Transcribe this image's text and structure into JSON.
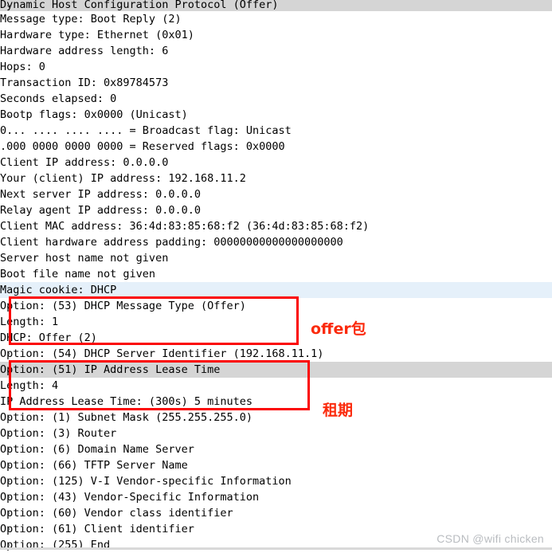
{
  "window": {
    "app": "Wireshark packet detail pane",
    "watermark": "CSDN @wifi chicken"
  },
  "icons": {
    "expanded": "⌄",
    "collapsed": "›"
  },
  "tree": {
    "rows": [
      {
        "twisty": "expanded",
        "indent": 0,
        "text": "Dynamic Host Configuration Protocol (Offer)",
        "highlight": "grey"
      },
      {
        "twisty": "none",
        "indent": 1,
        "text": "Message type: Boot Reply (2)",
        "highlight": "none"
      },
      {
        "twisty": "none",
        "indent": 1,
        "text": "Hardware type: Ethernet (0x01)",
        "highlight": "none"
      },
      {
        "twisty": "none",
        "indent": 1,
        "text": "Hardware address length: 6",
        "highlight": "none"
      },
      {
        "twisty": "none",
        "indent": 1,
        "text": "Hops: 0",
        "highlight": "none"
      },
      {
        "twisty": "none",
        "indent": 1,
        "text": "Transaction ID: 0x89784573",
        "highlight": "none"
      },
      {
        "twisty": "none",
        "indent": 1,
        "text": "Seconds elapsed: 0",
        "highlight": "none"
      },
      {
        "twisty": "expanded",
        "indent": 1,
        "text": "Bootp flags: 0x0000 (Unicast)",
        "highlight": "none"
      },
      {
        "twisty": "none",
        "indent": 2,
        "text": "0... .... .... .... = Broadcast flag: Unicast",
        "highlight": "none"
      },
      {
        "twisty": "none",
        "indent": 2,
        "text": ".000 0000 0000 0000 = Reserved flags: 0x0000",
        "highlight": "none"
      },
      {
        "twisty": "none",
        "indent": 1,
        "text": "Client IP address: 0.0.0.0",
        "highlight": "none"
      },
      {
        "twisty": "none",
        "indent": 1,
        "text": "Your (client) IP address: 192.168.11.2",
        "highlight": "none"
      },
      {
        "twisty": "none",
        "indent": 1,
        "text": "Next server IP address: 0.0.0.0",
        "highlight": "none"
      },
      {
        "twisty": "none",
        "indent": 1,
        "text": "Relay agent IP address: 0.0.0.0",
        "highlight": "none"
      },
      {
        "twisty": "none",
        "indent": 1,
        "text": "Client MAC address: 36:4d:83:85:68:f2 (36:4d:83:85:68:f2)",
        "highlight": "none"
      },
      {
        "twisty": "none",
        "indent": 1,
        "text": "Client hardware address padding: 00000000000000000000",
        "highlight": "none"
      },
      {
        "twisty": "none",
        "indent": 1,
        "text": "Server host name not given",
        "highlight": "none"
      },
      {
        "twisty": "none",
        "indent": 1,
        "text": "Boot file name not given",
        "highlight": "none"
      },
      {
        "twisty": "none",
        "indent": 1,
        "text": "Magic cookie: DHCP",
        "highlight": "blue"
      },
      {
        "twisty": "expanded",
        "indent": 0,
        "text": "Option: (53) DHCP Message Type (Offer)",
        "highlight": "none"
      },
      {
        "twisty": "none",
        "indent": 1,
        "text": "Length: 1",
        "highlight": "none"
      },
      {
        "twisty": "none",
        "indent": 1,
        "text": "DHCP: Offer (2)",
        "highlight": "none"
      },
      {
        "twisty": "collapsed",
        "indent": 0,
        "text": "Option: (54) DHCP Server Identifier (192.168.11.1)",
        "highlight": "none"
      },
      {
        "twisty": "expanded",
        "indent": 0,
        "text": "Option: (51) IP Address Lease Time",
        "highlight": "grey"
      },
      {
        "twisty": "none",
        "indent": 1,
        "text": "Length: 4",
        "highlight": "none"
      },
      {
        "twisty": "none",
        "indent": 1,
        "text": "IP Address Lease Time: (300s) 5 minutes",
        "highlight": "none"
      },
      {
        "twisty": "collapsed",
        "indent": 0,
        "text": "Option: (1) Subnet Mask (255.255.255.0)",
        "highlight": "none"
      },
      {
        "twisty": "collapsed",
        "indent": 0,
        "text": "Option: (3) Router",
        "highlight": "none"
      },
      {
        "twisty": "collapsed",
        "indent": 0,
        "text": "Option: (6) Domain Name Server",
        "highlight": "none"
      },
      {
        "twisty": "collapsed",
        "indent": 0,
        "text": "Option: (66) TFTP Server Name",
        "highlight": "none"
      },
      {
        "twisty": "collapsed",
        "indent": 0,
        "text": "Option: (125) V-I Vendor-specific Information",
        "highlight": "none"
      },
      {
        "twisty": "collapsed",
        "indent": 0,
        "text": "Option: (43) Vendor-Specific Information",
        "highlight": "none"
      },
      {
        "twisty": "collapsed",
        "indent": 0,
        "text": "Option: (60) Vendor class identifier",
        "highlight": "none"
      },
      {
        "twisty": "collapsed",
        "indent": 0,
        "text": "Option: (61) Client identifier",
        "highlight": "none"
      },
      {
        "twisty": "collapsed",
        "indent": 0,
        "text": "Option: (255) End",
        "highlight": "none"
      }
    ]
  },
  "annotations": [
    {
      "id": "offer",
      "text": "offer包",
      "color": "#fb2a0c"
    },
    {
      "id": "lease",
      "text": "租期",
      "color": "#fb2a0c"
    }
  ],
  "colors": {
    "annotation_red": "#fb2a0c",
    "box_red": "#fb0505",
    "selected_row_grey": "#d5d5d5",
    "highlight_blue": "#e5f0fa",
    "text": "#000000",
    "twisty": "#555b60",
    "watermark": "#b9bcc0"
  }
}
